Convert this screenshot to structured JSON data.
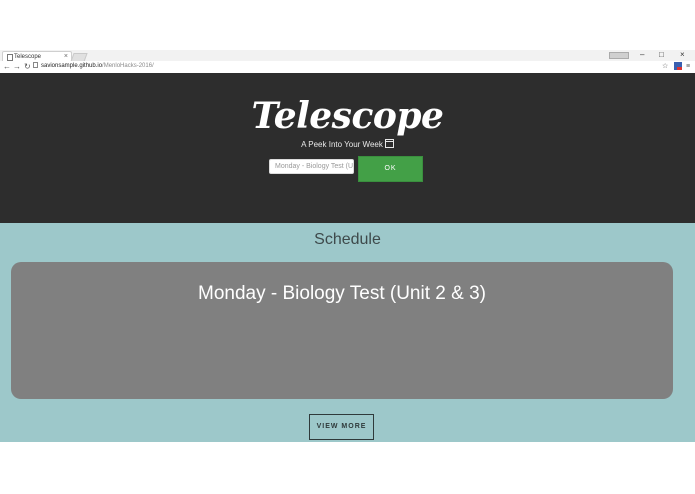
{
  "browser": {
    "tab_title": "Telescope",
    "tab_close": "×",
    "window_minimize": "–",
    "window_maximize": "□",
    "window_close": "×",
    "back": "←",
    "forward": "→",
    "reload": "↻",
    "url_host": "savionsample.github.io",
    "url_path": "/MenloHacks-2016/",
    "star": "☆",
    "menu": "≡"
  },
  "hero": {
    "logo": "Telescope",
    "tagline": "A Peek Into Your Week",
    "input_value": "Monday - Biology Test (U",
    "ok_label": "OK"
  },
  "schedule": {
    "title": "Schedule",
    "card_title": "Monday - Biology Test (Unit 2 & 3)",
    "view_more_label": "VIEW MORE"
  },
  "colors": {
    "hero_bg": "#2d2d2d",
    "section_bg": "#9dc8ca",
    "card_bg": "#808080",
    "ok_button": "#43a047"
  }
}
